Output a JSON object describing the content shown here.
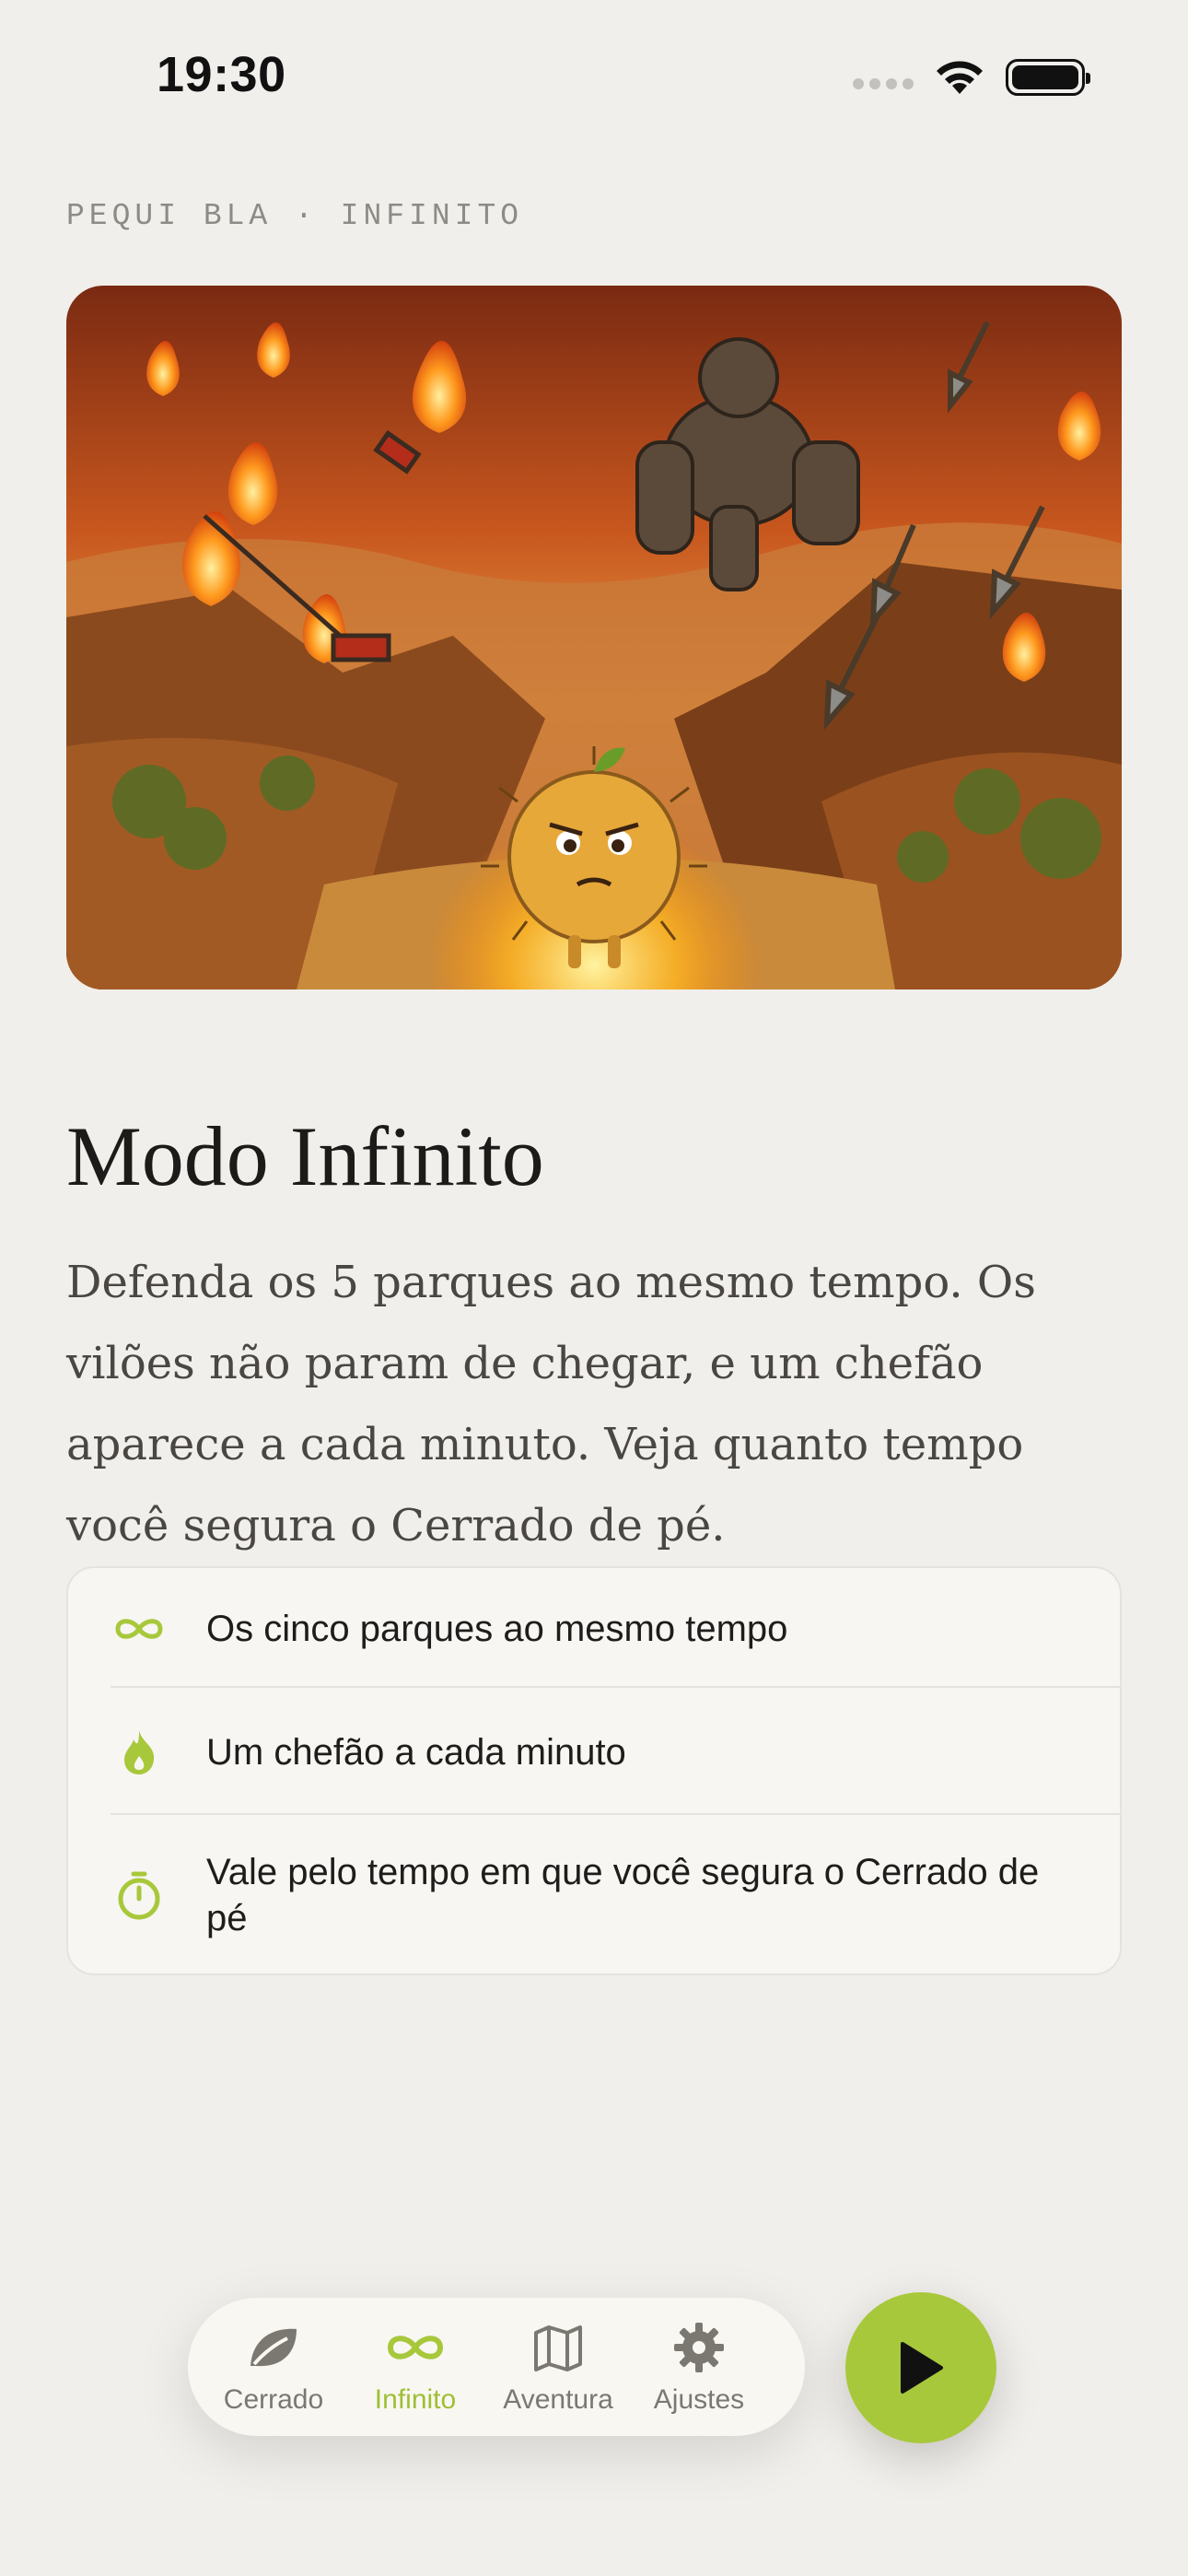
{
  "status_bar": {
    "time": "19:30"
  },
  "eyebrow": "PEQUI BLA · INFINITO",
  "title": "Modo Infinito",
  "description": "Defenda os 5 parques ao mesmo tempo. Os vilões não param de chegar, e um chefão aparece a cada minuto. Veja quanto tempo você segura o Cerrado de pé.",
  "features": [
    {
      "icon": "infinity-icon",
      "text": "Os cinco parques ao mesmo tempo"
    },
    {
      "icon": "flame-icon",
      "text": "Um chefão a cada minuto"
    },
    {
      "icon": "stopwatch-icon",
      "text": "Vale pelo tempo em que você segura o Cerrado de pé"
    }
  ],
  "tabs": [
    {
      "icon": "leaf-icon",
      "label": "Cerrado",
      "active": false
    },
    {
      "icon": "infinity-icon",
      "label": "Infinito",
      "active": true
    },
    {
      "icon": "map-icon",
      "label": "Aventura",
      "active": false
    },
    {
      "icon": "gear-icon",
      "label": "Ajustes",
      "active": false
    }
  ],
  "colors": {
    "accent": "#a8c83b",
    "background": "#f1efeb",
    "muted": "#8e8b86"
  }
}
